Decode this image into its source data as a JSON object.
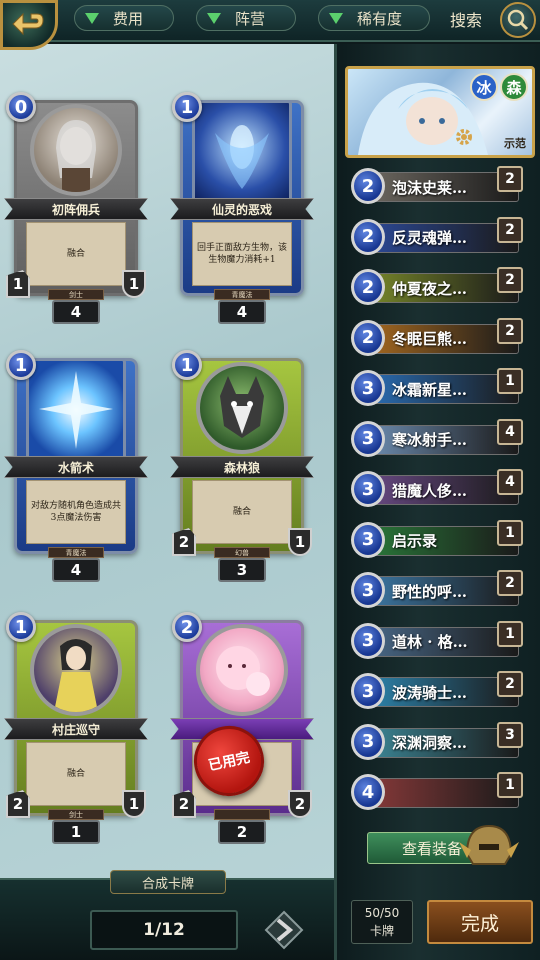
{
  "topbar": {
    "filters": [
      {
        "label": "费用"
      },
      {
        "label": "阵营"
      },
      {
        "label": "稀有度"
      }
    ],
    "search_label": "搜索"
  },
  "collection": {
    "cards": [
      {
        "cost": "0",
        "name": "初阵佣兵",
        "text": "融合",
        "type": "剑士",
        "attack": "1",
        "health": "1",
        "count": "4",
        "frame": "gray",
        "used_up": false
      },
      {
        "cost": "1",
        "name": "仙灵的恶戏",
        "text": "回手正面敌方生物，该生物魔力消耗+1",
        "type": "青魔法",
        "attack": "",
        "health": "",
        "count": "4",
        "frame": "blue",
        "used_up": false
      },
      {
        "cost": "1",
        "name": "水箭术",
        "text": "对敌方随机角色造成共3点魔法伤害",
        "type": "青魔法",
        "attack": "",
        "health": "",
        "count": "4",
        "frame": "blue",
        "used_up": false
      },
      {
        "cost": "1",
        "name": "森林狼",
        "text": "融合",
        "type": "幻兽",
        "attack": "2",
        "health": "1",
        "count": "3",
        "frame": "green",
        "used_up": false
      },
      {
        "cost": "1",
        "name": "村庄巡守",
        "text": "融合",
        "type": "剑士",
        "attack": "2",
        "health": "1",
        "count": "1",
        "frame": "green",
        "used_up": false
      },
      {
        "cost": "2",
        "name": "",
        "text": "",
        "type": "",
        "attack": "2",
        "health": "2",
        "count": "2",
        "frame": "purple",
        "used_up": true,
        "stamp": "已用完"
      }
    ]
  },
  "bottombar": {
    "craft_label": "合成卡牌",
    "page": "1/12"
  },
  "deck": {
    "hero_name": "示范",
    "elements": [
      "冰",
      "森"
    ],
    "cards": [
      {
        "cost": "2",
        "name": "泡沫史莱…",
        "qty": "2",
        "color": "#6f6a62"
      },
      {
        "cost": "2",
        "name": "反灵魂弹…",
        "qty": "2",
        "color": "#2c4a9a"
      },
      {
        "cost": "2",
        "name": "仲夏夜之…",
        "qty": "2",
        "color": "#7a8a2a"
      },
      {
        "cost": "2",
        "name": "冬眠巨熊…",
        "qty": "2",
        "color": "#a86a20"
      },
      {
        "cost": "3",
        "name": "冰霜新星…",
        "qty": "1",
        "color": "#2a6fb8"
      },
      {
        "cost": "3",
        "name": "寒冰射手…",
        "qty": "4",
        "color": "#6f8fb4"
      },
      {
        "cost": "3",
        "name": "猎魔人侈…",
        "qty": "4",
        "color": "#6a4a86"
      },
      {
        "cost": "3",
        "name": "启示录",
        "qty": "1",
        "color": "#2a7a3a"
      },
      {
        "cost": "3",
        "name": "野性的呼…",
        "qty": "2",
        "color": "#3d7aa8"
      },
      {
        "cost": "3",
        "name": "道林 · 格…",
        "qty": "1",
        "color": "#4a6a8a"
      },
      {
        "cost": "3",
        "name": "波涛骑士…",
        "qty": "2",
        "color": "#2d86b0"
      },
      {
        "cost": "3",
        "name": "深渊洞察…",
        "qty": "3",
        "color": "#3d8a9a"
      },
      {
        "cost": "4",
        "name": "",
        "qty": "1",
        "color": "#8a3a3a"
      }
    ],
    "view_equipment_label": "查看装备",
    "count_value": "50/50",
    "count_label": "卡牌",
    "done_label": "完成"
  },
  "colors": {
    "gold_border": "#c9a24a",
    "cost_blue": "#1c3b9a",
    "filter_green": "#5bd06d",
    "stamp_red": "#c2140f"
  }
}
